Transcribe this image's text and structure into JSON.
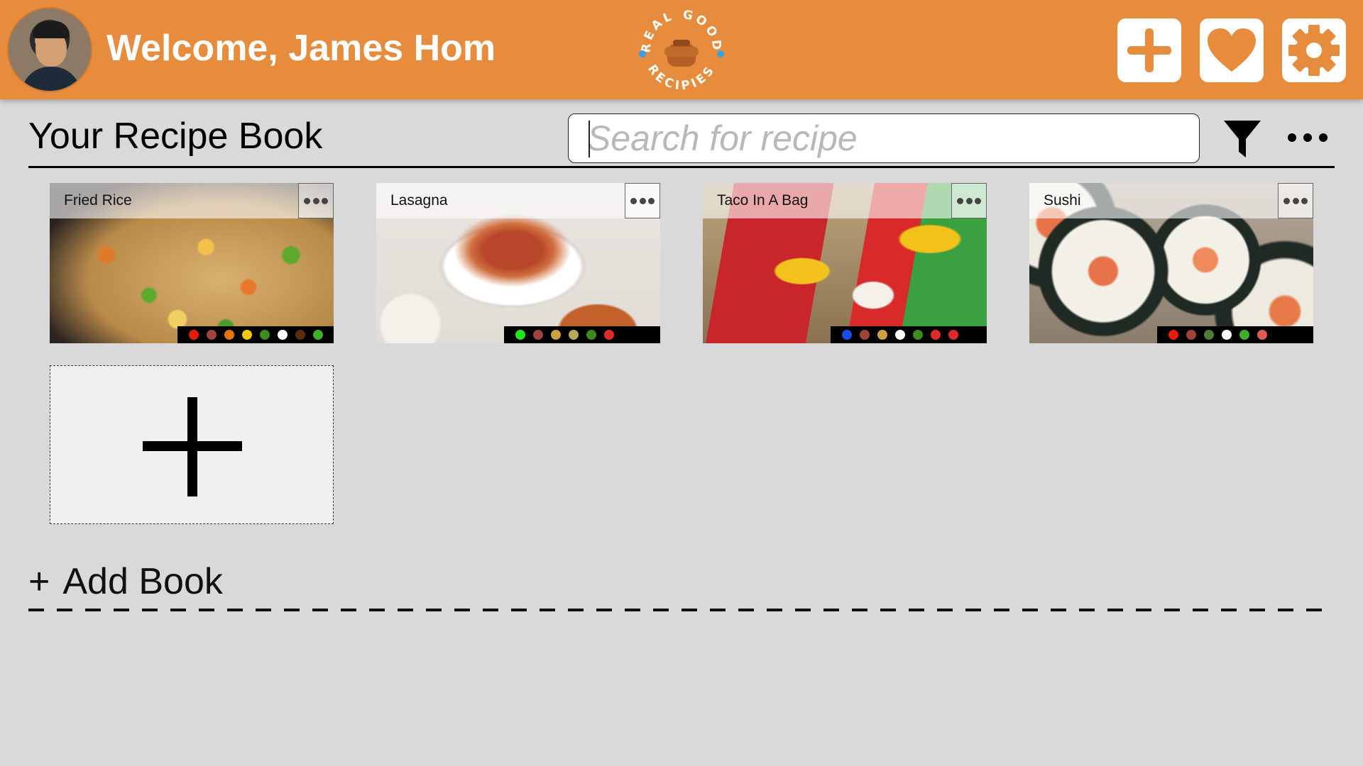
{
  "header": {
    "welcome_text": "Welcome, James Hom",
    "logo_text_top": "REAL GOOD",
    "logo_text_bottom": "RECIPIES",
    "accent_color": "#e68c3c",
    "buttons": [
      {
        "name": "add-recipe",
        "icon": "plus-icon"
      },
      {
        "name": "favorites",
        "icon": "heart-icon"
      },
      {
        "name": "settings",
        "icon": "gear-icon"
      }
    ]
  },
  "toolbar": {
    "title": "Your Recipe Book",
    "search_placeholder": "Search for recipe",
    "filter_icon": "filter-icon",
    "more_icon": "more-horizontal-icon"
  },
  "recipes": [
    {
      "title": "Fried Rice",
      "tags": [
        "#e81a0c",
        "#a0413c",
        "#e8730c",
        "#f2c80a",
        "#3d8a1e",
        "#ffffff",
        "#5a2e0e",
        "#3fae2a"
      ]
    },
    {
      "title": "Lasagna",
      "tags": [
        "#1ee61a",
        "#a0413c",
        "#d0a040",
        "#b8a85a",
        "#3d8a1e",
        "#e02a2a"
      ]
    },
    {
      "title": "Taco In A Bag",
      "tags": [
        "#1a4ee6",
        "#a0413c",
        "#d0a040",
        "#ffffff",
        "#3d8a1e",
        "#e02a2a",
        "#e02a2a"
      ]
    },
    {
      "title": "Sushi",
      "tags": [
        "#e81a0c",
        "#a0413c",
        "#4e7a3a",
        "#ffffff",
        "#3fae2a",
        "#e05a5a"
      ]
    }
  ],
  "add_book": {
    "plus": "+",
    "label": "Add Book"
  }
}
